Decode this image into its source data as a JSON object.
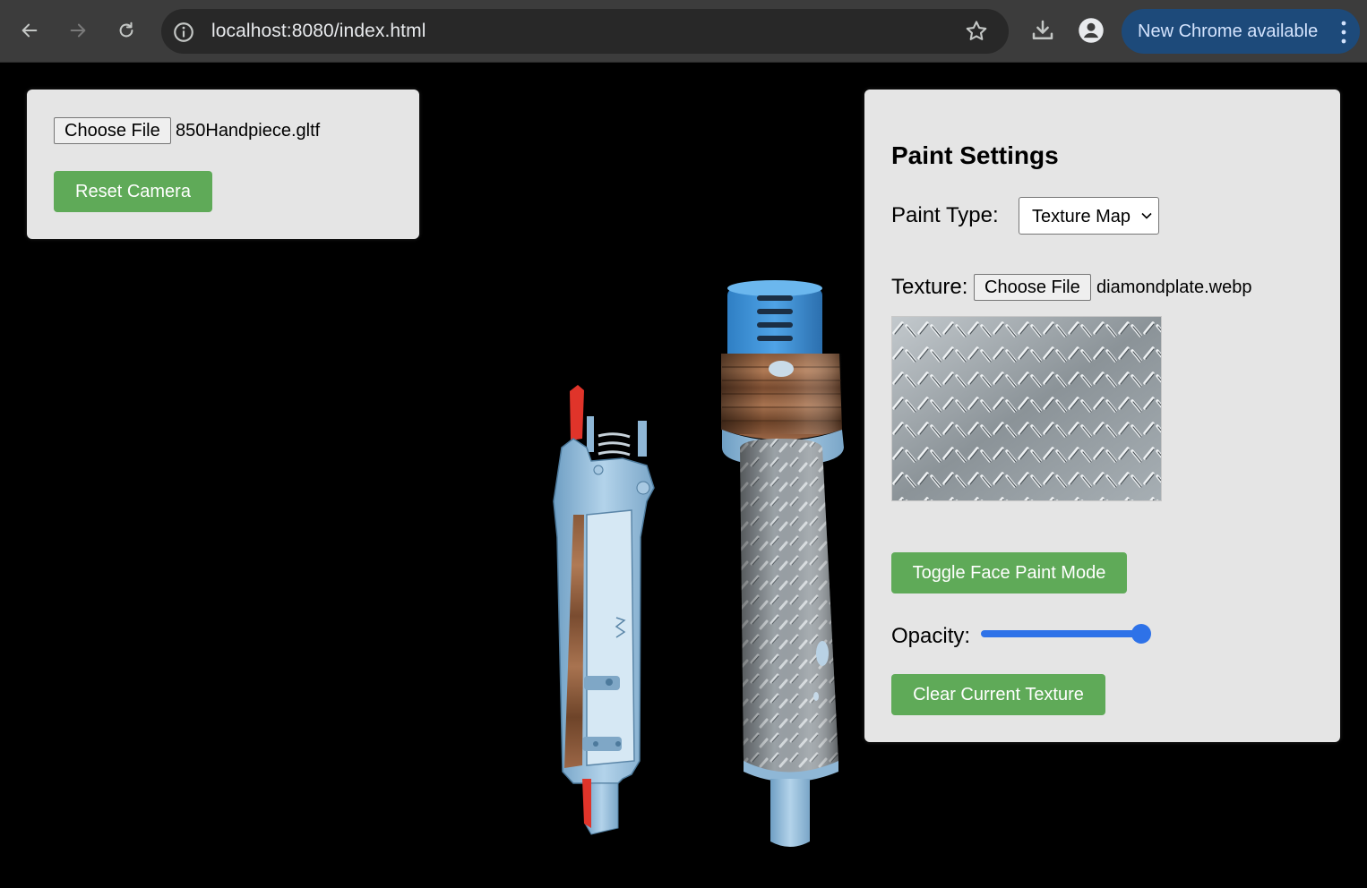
{
  "browser": {
    "url": "localhost:8080/index.html",
    "update_label": "New Chrome available",
    "icons": [
      "back-arrow-icon",
      "forward-arrow-icon",
      "reload-icon",
      "info-icon",
      "star-icon",
      "download-icon",
      "profile-icon",
      "kebab-menu-icon"
    ]
  },
  "left_panel": {
    "choose_file_label": "Choose File",
    "file_name": "850Handpiece.gltf",
    "reset_camera_label": "Reset Camera"
  },
  "paint_settings": {
    "heading": "Paint Settings",
    "paint_type_label": "Paint Type:",
    "paint_type_value": "Texture Map",
    "texture_label": "Texture:",
    "texture_choose_label": "Choose File",
    "texture_file_name": "diamondplate.webp",
    "toggle_face_paint_label": "Toggle Face Paint Mode",
    "opacity_label": "Opacity:",
    "opacity_value": 1.0,
    "clear_texture_label": "Clear Current Texture"
  },
  "colors": {
    "button_green": "#5faa58",
    "panel_bg": "#e5e5e5",
    "slider_blue": "#2e72e8",
    "viewport_bg": "#000000"
  }
}
